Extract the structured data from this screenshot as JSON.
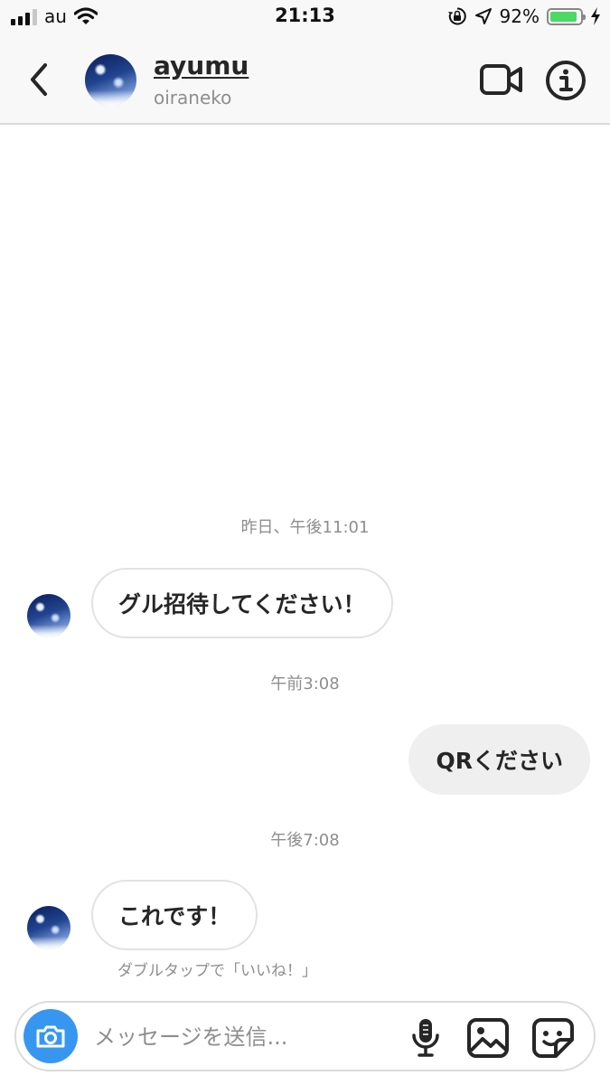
{
  "status_bar": {
    "carrier": "au",
    "time": "21:13",
    "battery_percent": "92%",
    "battery_level": 0.92,
    "icons": [
      "signal-icon",
      "wifi-icon",
      "rotation-lock-icon",
      "location-arrow-icon",
      "battery-icon",
      "charging-bolt-icon"
    ]
  },
  "header": {
    "name": "ayumu",
    "username": "oiraneko",
    "icons": [
      "back-chevron-icon",
      "video-call-icon",
      "info-icon"
    ]
  },
  "messages": [
    {
      "type": "timestamp",
      "text": "昨日、午後11:01"
    },
    {
      "type": "incoming",
      "text": "グル招待してください！"
    },
    {
      "type": "timestamp",
      "text": "午前3:08"
    },
    {
      "type": "outgoing",
      "text": "QRください"
    },
    {
      "type": "timestamp",
      "text": "午後7:08"
    },
    {
      "type": "incoming",
      "text": "これです！"
    }
  ],
  "like_hint": "ダブルタップで「いいね！」",
  "composer": {
    "placeholder": "メッセージを送信...",
    "icons": [
      "camera-icon",
      "microphone-icon",
      "gallery-icon",
      "sticker-icon"
    ]
  },
  "colors": {
    "accent": "#3797f0",
    "battery": "#4cd964",
    "bar_background": "#f8f8f8",
    "outgoing_bubble": "#efefef",
    "muted_text": "#8e8e8e"
  }
}
